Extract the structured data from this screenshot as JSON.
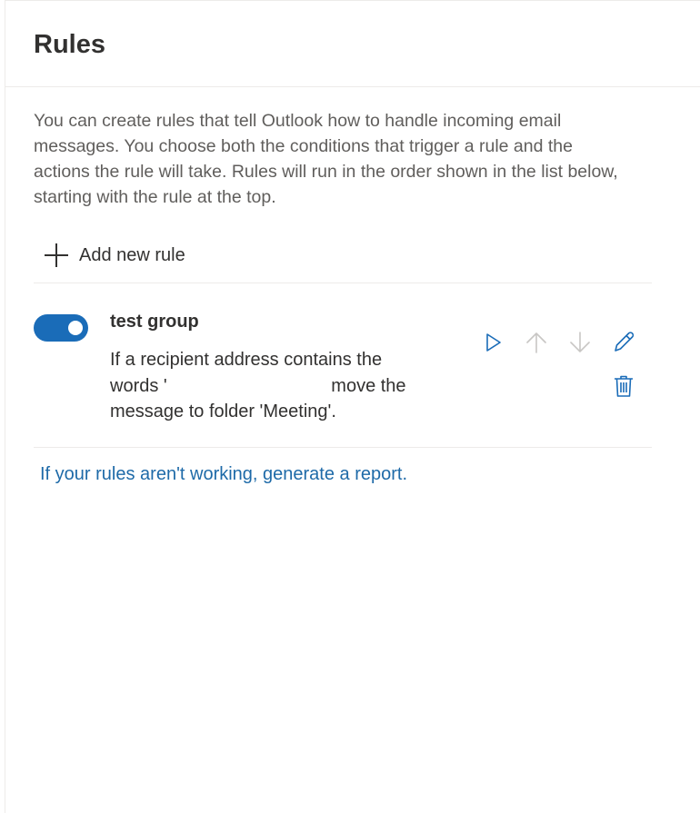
{
  "header": {
    "title": "Rules"
  },
  "description": "You can create rules that tell Outlook how to handle incoming email messages. You choose both the conditions that trigger a rule and the actions the rule will take. Rules will run in the order shown in the list below, starting with the rule at the top.",
  "add_rule": {
    "label": "Add new rule",
    "icon": "plus-icon"
  },
  "rules": [
    {
      "name": "test group",
      "enabled": true,
      "description_part1": "If a recipient address contains the words '",
      "description_part2": " move the message to folder 'Meeting'.",
      "actions": {
        "run": "play-icon",
        "move_up": "arrow-up-icon",
        "move_down": "arrow-down-icon",
        "edit": "pencil-icon",
        "delete": "trash-icon"
      }
    }
  ],
  "footer": {
    "report_link": "If your rules aren't working, generate a report."
  },
  "colors": {
    "accent": "#1a6cb8",
    "link": "#1e6aa8",
    "disabled_icon": "#c8c6c4"
  }
}
